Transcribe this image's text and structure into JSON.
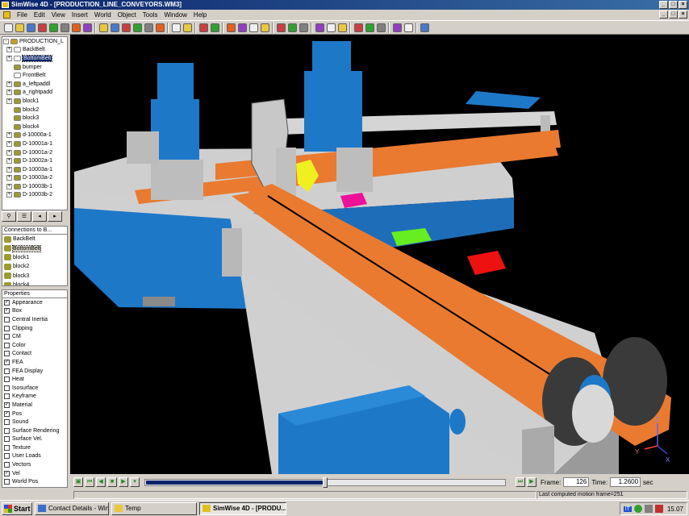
{
  "window": {
    "title": "SimWise 4D - [PRODUCTION_LINE_CONVEYORS.WM3]",
    "min_label": "_",
    "max_label": "□",
    "close_label": "×"
  },
  "menu": [
    "File",
    "Edit",
    "View",
    "Insert",
    "World",
    "Object",
    "Tools",
    "Window",
    "Help"
  ],
  "toolbar_icons": [
    "new",
    "open",
    "save",
    "cut",
    "copy",
    "paste",
    "undo",
    "redo",
    "sep",
    "move",
    "rotate",
    "scale",
    "zoom",
    "fit",
    "zoom-box",
    "sep",
    "render",
    "wire",
    "sep",
    "select",
    "snap",
    "sep",
    "box",
    "sphere",
    "cylinder",
    "cone",
    "sep",
    "joint",
    "spring",
    "rope",
    "sep",
    "force",
    "motor",
    "sensor",
    "sep",
    "camera",
    "light",
    "meter",
    "sep",
    "run",
    "reset",
    "sep",
    "track"
  ],
  "tree": {
    "items": [
      {
        "label": "PRODUCTION_L",
        "exp": "-",
        "icon": "#c8a020"
      },
      {
        "label": "BackBelt",
        "exp": "+",
        "icon": "#ffffff"
      },
      {
        "label": "BottomBelt",
        "exp": "+",
        "icon": "#ffffff",
        "selected": true
      },
      {
        "label": "bumper",
        "exp": "",
        "icon": "#9c9a30"
      },
      {
        "label": "FrontBelt",
        "exp": "",
        "icon": "#ffffff"
      },
      {
        "label": "a_leftpaddl",
        "exp": "+",
        "icon": "#9c9a30"
      },
      {
        "label": "a_rightpadd",
        "exp": "+",
        "icon": "#9c9a30"
      },
      {
        "label": "block1",
        "exp": "+",
        "icon": "#9c9a30"
      },
      {
        "label": "block2",
        "exp": "",
        "icon": "#9c9a30"
      },
      {
        "label": "block3",
        "exp": "",
        "icon": "#9c9a30"
      },
      {
        "label": "block4",
        "exp": "",
        "icon": "#9c9a30"
      },
      {
        "label": "d-10000a-1",
        "exp": "+",
        "icon": "#9c9a30"
      },
      {
        "label": "D-10001a-1",
        "exp": "+",
        "icon": "#9c9a30"
      },
      {
        "label": "D-10001a-2",
        "exp": "+",
        "icon": "#9c9a30"
      },
      {
        "label": "D-10002a-1",
        "exp": "+",
        "icon": "#9c9a30"
      },
      {
        "label": "D-10003a-1",
        "exp": "+",
        "icon": "#9c9a30"
      },
      {
        "label": "D-10003a-2",
        "exp": "+",
        "icon": "#9c9a30"
      },
      {
        "label": "D-10003b-1",
        "exp": "+",
        "icon": "#9c9a30"
      },
      {
        "label": "D-10003b-2",
        "exp": "+",
        "icon": "#9c9a30"
      }
    ],
    "tabs": [
      "tree",
      "list",
      "props",
      "more"
    ]
  },
  "connections": {
    "header": "Connections to B...",
    "items": [
      "BackBelt",
      "BottomBelt",
      "block1",
      "block2",
      "block3",
      "block4"
    ]
  },
  "properties": {
    "header": "Properties",
    "items": [
      {
        "label": "Appearance",
        "checked": true
      },
      {
        "label": "Box",
        "checked": true
      },
      {
        "label": "Central Inertia",
        "checked": false
      },
      {
        "label": "Clipping",
        "checked": false
      },
      {
        "label": "CM",
        "checked": false
      },
      {
        "label": "Color",
        "checked": false
      },
      {
        "label": "Contact",
        "checked": false
      },
      {
        "label": "FEA",
        "checked": true
      },
      {
        "label": "FEA Display",
        "checked": false
      },
      {
        "label": "Heat",
        "checked": false
      },
      {
        "label": "Isosurface",
        "checked": false
      },
      {
        "label": "Keyframe",
        "checked": false
      },
      {
        "label": "Material",
        "checked": true
      },
      {
        "label": "Pos",
        "checked": true
      },
      {
        "label": "Sound",
        "checked": false
      },
      {
        "label": "Surface Rendering",
        "checked": false
      },
      {
        "label": "Surface Vel.",
        "checked": false
      },
      {
        "label": "Texture",
        "checked": false
      },
      {
        "label": "User Loads",
        "checked": false
      },
      {
        "label": "Vectors",
        "checked": false
      },
      {
        "label": "Vel",
        "checked": true
      },
      {
        "label": "World Pos",
        "checked": false
      }
    ]
  },
  "playback": {
    "frame_label": "Frame:",
    "frame_value": "126",
    "time_label": "Time:",
    "time_value": "1.2600",
    "time_unit": "sec",
    "progress": 0.5
  },
  "status": {
    "message": "Last computed motion frame=251"
  },
  "axis": {
    "x": "X",
    "y": "Y",
    "z": "Z"
  },
  "taskbar": {
    "start_label": "Start",
    "tasks": [
      {
        "label": "Contact Details - Windo...",
        "active": false
      },
      {
        "label": "Temp",
        "active": false
      },
      {
        "label": "SimWise 4D - [PRODU...",
        "active": true
      }
    ],
    "lang": "IT",
    "clock": "15.07"
  },
  "colors": {
    "belt": "#e97a30",
    "frame_gray": "#c8c8c8",
    "base_blue": "#1e78c8",
    "block_red": "#ee1111",
    "block_green": "#66ee22",
    "block_magenta": "#ee1199",
    "block_yellow": "#f0f020"
  }
}
